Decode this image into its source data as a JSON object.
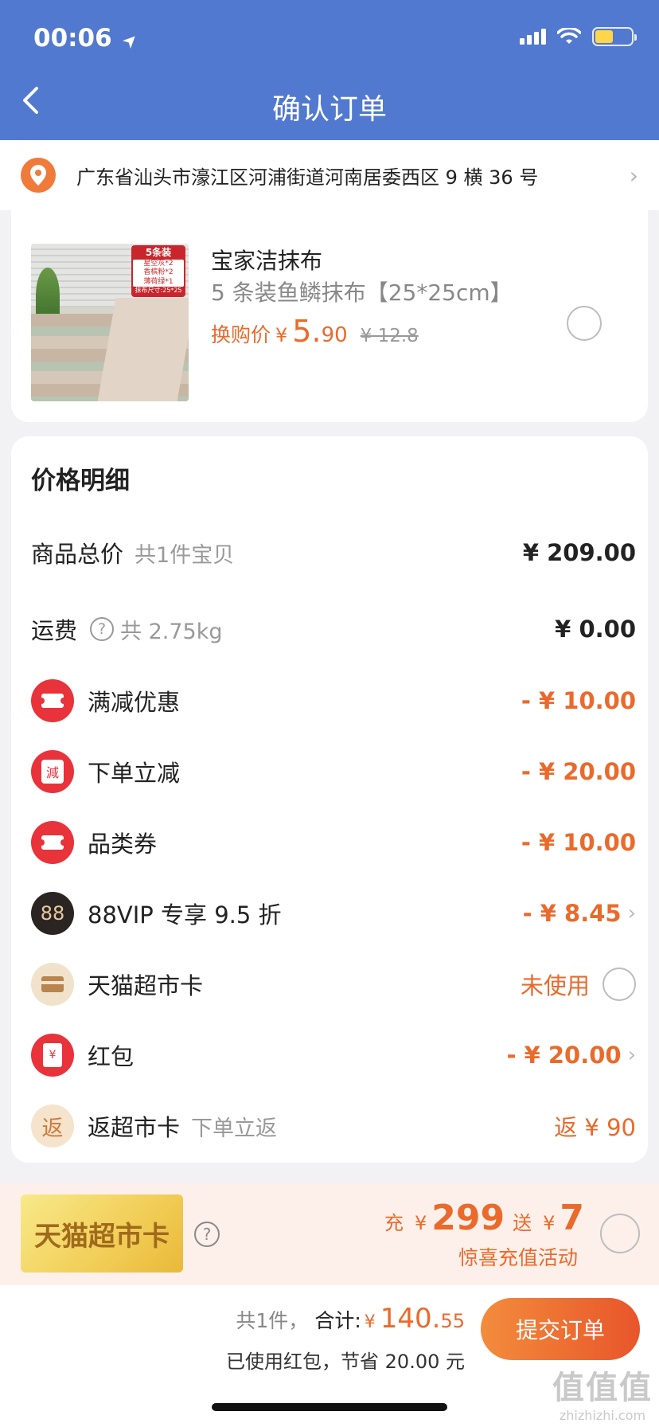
{
  "status_bar": {
    "time": "00:06",
    "location_arrow": "➤"
  },
  "nav": {
    "back_icon": "‹",
    "title": "确认订单"
  },
  "address": {
    "icon": "location-pin",
    "text": "广东省汕头市濠江区河浦街道河南居委西区 9 横 36 号",
    "chevron": "›"
  },
  "product": {
    "badge_head": "5条装",
    "badge_lines": [
      "星空灰*2",
      "香槟粉*2",
      "薄荷绿*1"
    ],
    "badge_size": "抹布尺寸:25*25",
    "name": "宝家洁抹布",
    "spec": "5 条装鱼鳞抹布【25*25cm】",
    "price_label": "换购价",
    "price_yen": "¥",
    "price_int": "5.",
    "price_dec": "90",
    "original_price": "¥ 12.8"
  },
  "price_detail": {
    "title": "价格明细",
    "goods_total_label": "商品总价",
    "goods_total_sub": "共1件宝贝",
    "goods_total_value": "¥ 209.00",
    "shipping_label": "运费",
    "shipping_q": "?",
    "shipping_sub": "共 2.75kg",
    "shipping_value": "¥ 0.00",
    "discounts": [
      {
        "label": "满减优惠",
        "value": "- ¥ 10.00"
      },
      {
        "label": "下单立减",
        "value": "- ¥ 20.00",
        "icon_text": "減"
      },
      {
        "label": "品类券",
        "value": "- ¥ 10.00"
      },
      {
        "label": "88VIP 专享 9.5 折",
        "value": "- ¥ 8.45",
        "icon_text": "88",
        "chevron": "›"
      },
      {
        "label": "天猫超市卡",
        "value": "未使用"
      },
      {
        "label": "红包",
        "value": "- ¥ 20.00",
        "icon_text": "¥",
        "chevron": "›"
      },
      {
        "label": "返超市卡",
        "sub": "下单立返",
        "value": "返 ¥ 90",
        "icon_text": "返"
      }
    ]
  },
  "promo": {
    "card_label": "天猫超市卡",
    "q": "?",
    "charge_label": "充",
    "yen": "¥",
    "charge_amount": "299",
    "gift_label": "送",
    "gift_amount": "7",
    "subtitle": "惊喜充值活动"
  },
  "footer": {
    "count": "共1件，",
    "total_label": "合计:",
    "yen": "¥",
    "total_int": "140.",
    "total_dec": "55",
    "savings": "已使用红包，节省 20.00 元",
    "submit": "提交订单"
  },
  "watermark": {
    "big": "值值值",
    "small": "zhizhizhi.com"
  },
  "colors": {
    "header_blue": "#5179cf",
    "accent_orange": "#ea6a2c",
    "coupon_red": "#e8333b"
  }
}
